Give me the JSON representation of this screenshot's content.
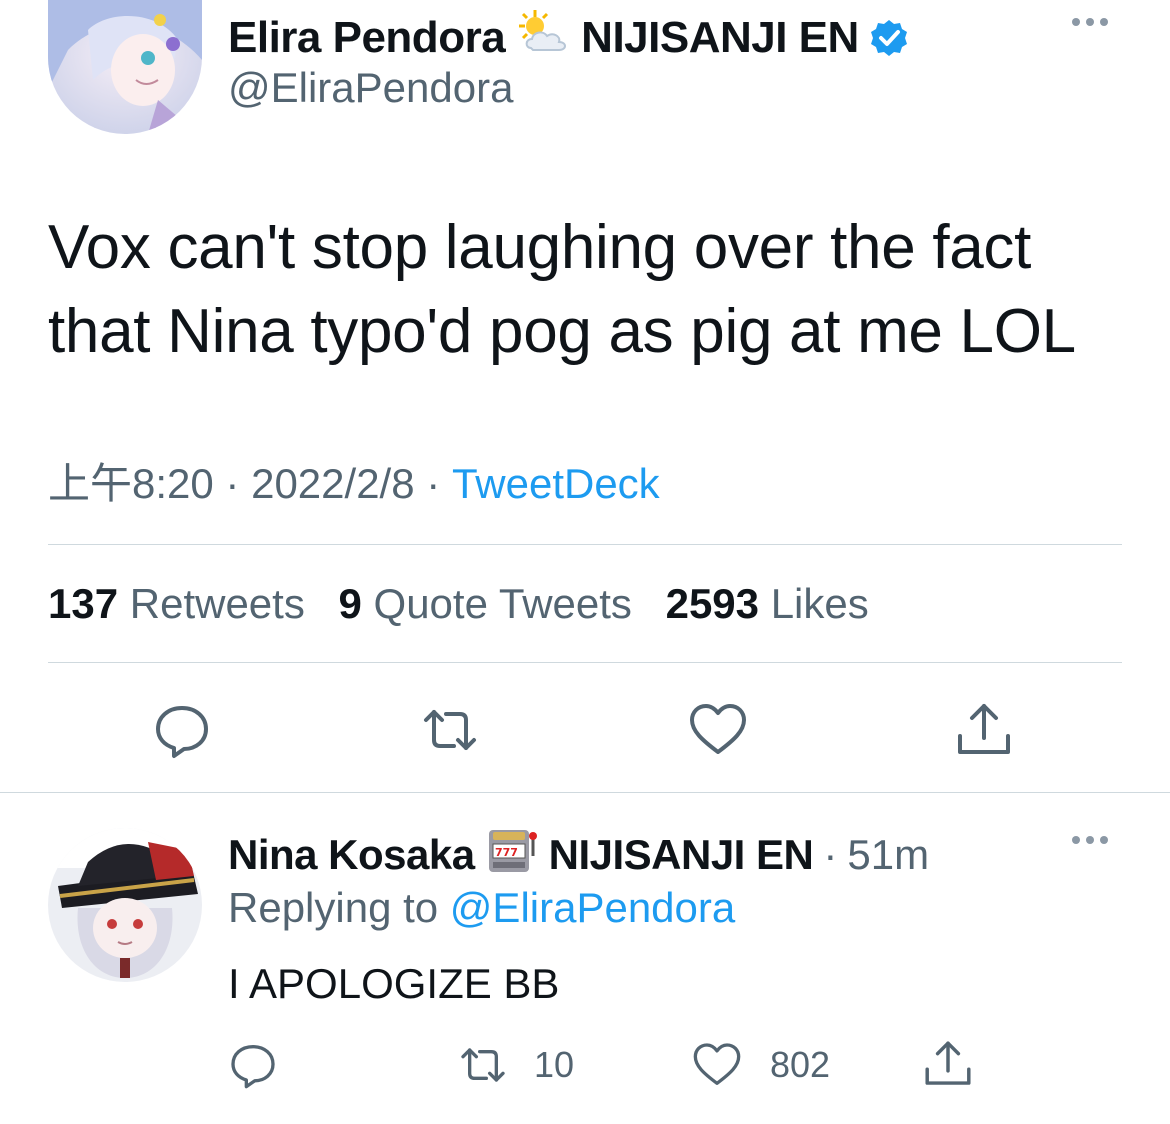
{
  "tweet": {
    "author_name": "Elira Pendora",
    "author_emoji": "sun-behind-cloud-icon",
    "author_org": "NIJISANJI EN",
    "author_handle": "@EliraPendora",
    "text": "Vox can't stop laughing over the fact that Nina typo'd pog as pig at me LOL",
    "time": "上午8:20",
    "date": "2022/2/8",
    "separator": "·",
    "source": "TweetDeck",
    "stats": {
      "retweets_count": "137",
      "retweets_label": "Retweets",
      "quotes_count": "9",
      "quotes_label": "Quote Tweets",
      "likes_count": "2593",
      "likes_label": "Likes"
    }
  },
  "reply": {
    "author_name": "Nina Kosaka",
    "author_emoji": "slot-machine-icon",
    "author_org": "NIJISANJI EN",
    "separator": "·",
    "time": "51m",
    "replying_prefix": "Replying to",
    "replying_handle": "@EliraPendora",
    "text": "I APOLOGIZE BB",
    "retweets_count": "10",
    "likes_count": "802"
  },
  "colors": {
    "text": "#0f1419",
    "secondary": "#536471",
    "accent": "#1d9bf0",
    "divider": "#cfd9de"
  }
}
